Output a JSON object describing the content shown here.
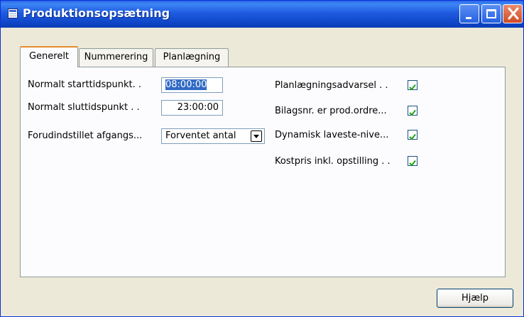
{
  "window": {
    "title": "Produktionsopsætning"
  },
  "tabs": [
    {
      "label": "Generelt",
      "active": true
    },
    {
      "label": "Nummerering",
      "active": false
    },
    {
      "label": "Planlægning",
      "active": false
    }
  ],
  "left_fields": {
    "start_time": {
      "label": "Normalt starttidspunkt. .",
      "value": "08:00:00"
    },
    "end_time": {
      "label": "Normalt sluttidspunkt . .",
      "value": "23:00:00"
    },
    "preset_output": {
      "label": "Forudindstillet afgangs...",
      "value": "Forventet antal"
    }
  },
  "right_fields": [
    {
      "label": "Planlægningsadvarsel . .",
      "checked": true
    },
    {
      "label": "Bilagsnr. er prod.ordre...",
      "checked": true
    },
    {
      "label": "Dynamisk laveste-nive...",
      "checked": true
    },
    {
      "label": "Kostpris inkl. opstilling . .",
      "checked": true
    }
  ],
  "footer": {
    "help_label": "Hjælp"
  },
  "colors": {
    "title_bar": "#0F47C8",
    "selection": "#316AC5",
    "checkmark": "#21A121"
  }
}
